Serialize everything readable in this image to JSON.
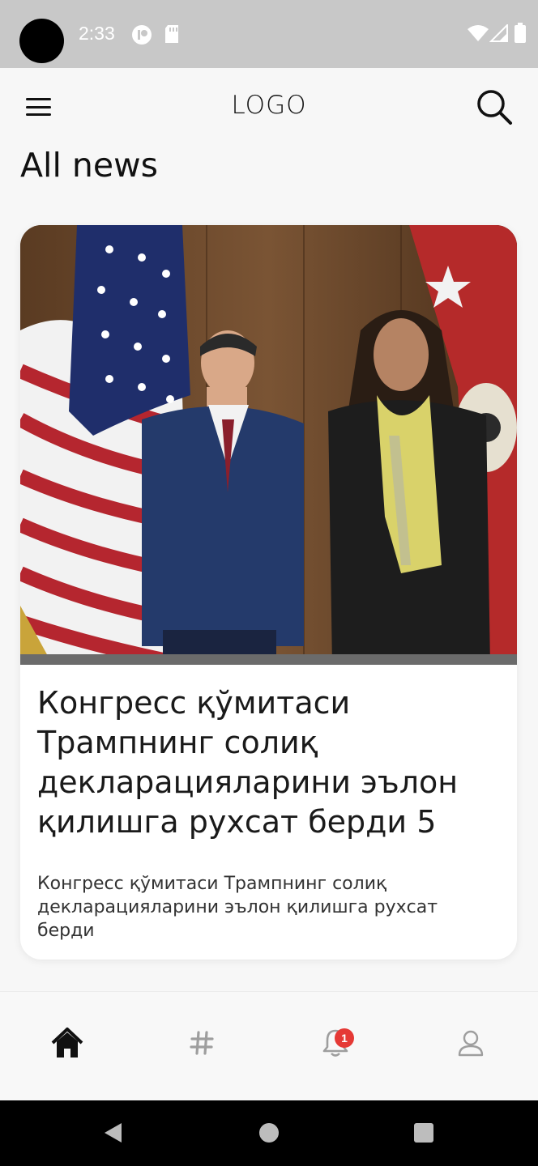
{
  "status_bar": {
    "time": "2:33",
    "icons": [
      "vpn-key-icon",
      "sd-card-icon",
      "wifi-icon",
      "signal-icon",
      "battery-icon"
    ]
  },
  "header": {
    "logo": "LOGO",
    "menu_icon": "hamburger-menu-icon",
    "search_icon": "search-icon"
  },
  "page": {
    "title": "All news"
  },
  "news": [
    {
      "title": "Конгресс қўмитаси Трампнинг солиқ декларацияларини эълон қилишга рухсат берди 5",
      "summary": "Конгресс қўмитаси Трампнинг солиқ декларацияларини эълон қилишга рухсат берди"
    }
  ],
  "bottom_nav": {
    "items": [
      {
        "icon": "home-icon",
        "active": true
      },
      {
        "icon": "hashtag-icon",
        "active": false
      },
      {
        "icon": "bell-icon",
        "active": false,
        "badge": "1"
      },
      {
        "icon": "profile-icon",
        "active": false
      }
    ]
  },
  "system_nav": {
    "icons": [
      "back-icon",
      "home-circle-icon",
      "recents-icon"
    ]
  },
  "colors": {
    "status_bar": "#c8c8c8",
    "badge": "#e53935",
    "active_icon": "#111111",
    "inactive_icon": "#9e9e9e"
  }
}
